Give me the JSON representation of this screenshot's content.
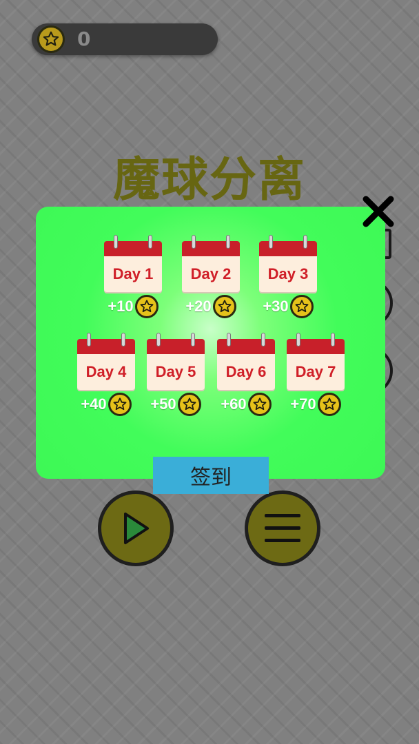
{
  "header": {
    "coin_count": "0",
    "coin_icon": "star-coin-icon"
  },
  "title": "魔球分离",
  "daily_checkin": {
    "days": [
      {
        "label": "Day 1",
        "reward": "+10"
      },
      {
        "label": "Day 2",
        "reward": "+20"
      },
      {
        "label": "Day 3",
        "reward": "+30"
      },
      {
        "label": "Day 4",
        "reward": "+40"
      },
      {
        "label": "Day 5",
        "reward": "+50"
      },
      {
        "label": "Day 6",
        "reward": "+60"
      },
      {
        "label": "Day 7",
        "reward": "+70"
      }
    ],
    "checkin_label": "签到",
    "close_icon": "close-x-icon"
  },
  "colors": {
    "modal_bg": "#42fc5a",
    "calendar_header": "#c8202a",
    "day_text": "#d01f28",
    "coin": "#e6c21a",
    "checkin_button": "#3aaed8",
    "title": "#676612"
  }
}
